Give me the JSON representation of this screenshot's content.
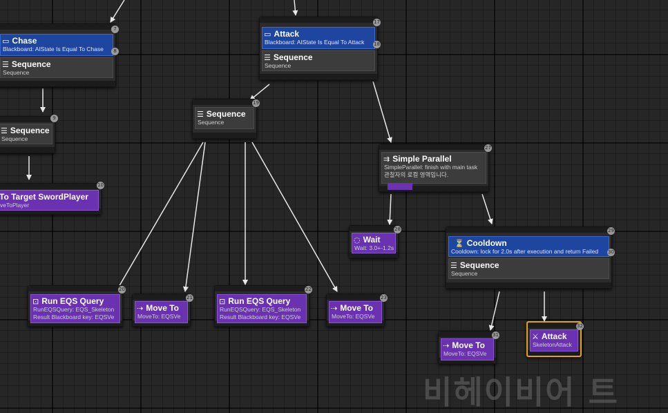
{
  "editor": {
    "watermark": "비헤이비어 트"
  },
  "nodes": {
    "chase": {
      "title": "Chase",
      "description": "Blackboard: AIState Is Equal To Chase",
      "composite_title": "Sequence",
      "composite_sub": "Sequence",
      "index_a": "7",
      "index_b": "8"
    },
    "attack_root": {
      "title": "Attack",
      "description": "Blackboard: AIState Is Equal To Attack",
      "composite_title": "Sequence",
      "composite_sub": "Sequence",
      "index_a": "17",
      "index_b": "18"
    },
    "sequence_left": {
      "title": "Sequence",
      "sub": "Sequence",
      "index": "9"
    },
    "move_to_target": {
      "title": "To Target SwordPlayer",
      "sub": "veToPlayer",
      "index": "10"
    },
    "sequence_mid": {
      "title": "Sequence",
      "sub": "Sequence",
      "index": "19"
    },
    "simple_parallel": {
      "title": "Simple Parallel",
      "line1": "SimpleParallel: finish with main task",
      "line2": "관찰자의 로컬 영역입니다.",
      "index": "27"
    },
    "wait": {
      "title": "Wait",
      "sub": "Wait: 3.0+-1.2s",
      "index": "28"
    },
    "cooldown": {
      "title": "Cooldown",
      "description": "Cooldown: lock for 2.0s after execution and return Failed",
      "composite_title": "Sequence",
      "composite_sub": "Sequence",
      "index_a": "29",
      "index_b": "30"
    },
    "run_eqs_1": {
      "title": "Run EQS Query",
      "line1": "RunEQSQuery: EQS_Skeleton",
      "line2": "Result Blackboard key: EQSVe",
      "index": "20"
    },
    "move_to_1": {
      "title": "Move To",
      "sub": "MoveTo: EQSVe",
      "index": "21"
    },
    "run_eqs_2": {
      "title": "Run EQS Query",
      "line1": "RunEQSQuery: EQS_Skeleton",
      "line2": "Result Blackboard key: EQSVe",
      "index": "22"
    },
    "move_to_2": {
      "title": "Move To",
      "sub": "MoveTo: EQSVe",
      "index": "23"
    },
    "move_to_3": {
      "title": "Move To",
      "sub": "MoveTo: EQSVe",
      "index": "31"
    },
    "attack_task": {
      "title": "Attack",
      "sub": "SkeletonAttack",
      "index": "32"
    }
  },
  "icons": {
    "decorator": "speech-bubble-icon",
    "sequence": "sequence-icon",
    "parallel": "parallel-icon",
    "wait": "wait-icon",
    "cooldown": "cooldown-icon",
    "eqs": "eqs-icon",
    "move": "move-arrow-icon",
    "attack": "attack-icon"
  },
  "colors": {
    "decorator": "#1e45a0",
    "task": "#6a32b0",
    "composite": "#3c3c3c",
    "selected_border": "#e2a21c",
    "wire": "#e8e8e8"
  }
}
